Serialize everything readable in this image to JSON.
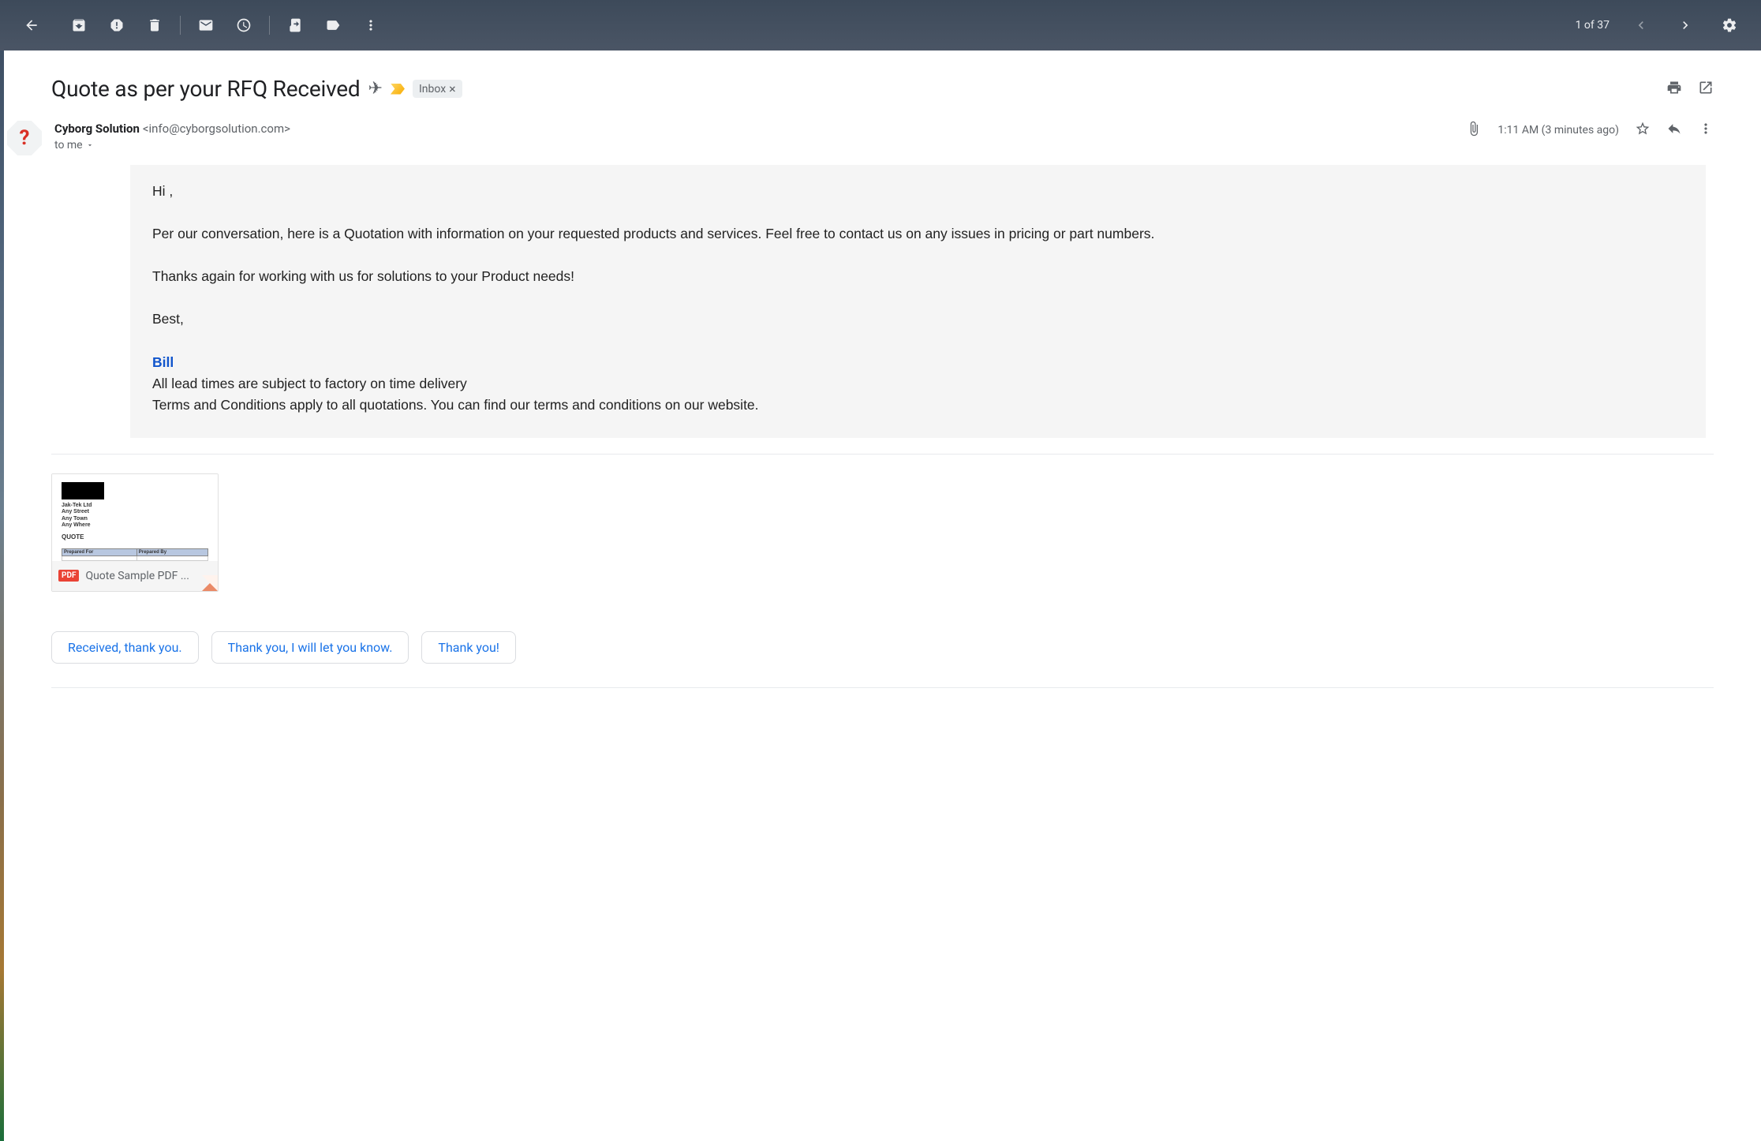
{
  "toolbar": {
    "page_counter": "1 of 37"
  },
  "subject": {
    "text": "Quote as per your RFQ Received",
    "label": "Inbox"
  },
  "sender": {
    "name": "Cyborg Solution",
    "email": "<info@cyborgsolution.com>",
    "to_text": "to me",
    "timestamp": "1:11 AM (3 minutes ago)",
    "avatar_char": "?"
  },
  "body": {
    "greeting": "Hi ,",
    "p1": "Per our conversation, here is a Quotation with information on your requested products and services. Feel free to contact us on any issues in pricing or part numbers.",
    "p2": "Thanks again for working with us for solutions to your Product needs!",
    "closing": "Best,",
    "signature_name": "Bill",
    "disclaimer1": "All lead times are subject to factory on time delivery",
    "disclaimer2": " Terms and Conditions apply to all quotations.  You can find our terms and conditions on our website."
  },
  "attachment": {
    "badge": "PDF",
    "filename": "Quote Sample PDF ...",
    "preview": {
      "line1": "Jak-Tek Ltd",
      "line2": "Any Street",
      "line3": "Any Town",
      "line4": "Any Where",
      "quote_label": "QUOTE",
      "col1": "Prepared For",
      "col2": "Prepared By"
    }
  },
  "smart_replies": {
    "r1": "Received, thank you.",
    "r2": "Thank you, I will let you know.",
    "r3": "Thank you!"
  }
}
